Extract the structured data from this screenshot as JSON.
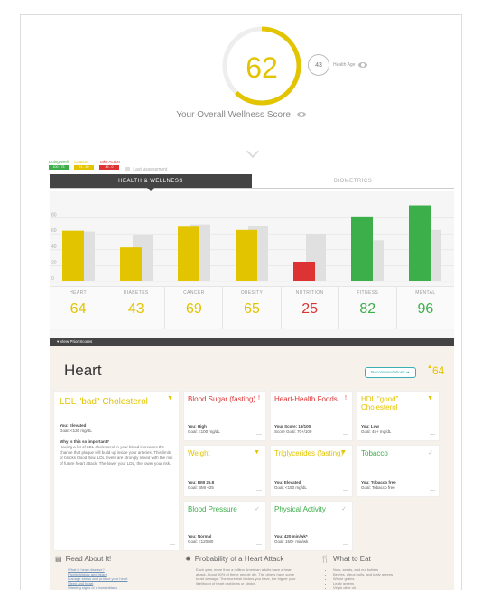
{
  "overall": {
    "score": "62",
    "score_value": 62,
    "label": "Your Overall Wellness Score"
  },
  "health_age": {
    "value": "43",
    "label": "Health Age"
  },
  "legend": [
    {
      "label": "Doing Well",
      "range": "100 - 75",
      "color": "#3cae4a"
    },
    {
      "label": "Caution",
      "range": "74 - 50",
      "color": "#e2c400"
    },
    {
      "label": "Take Action",
      "range": "49 - 0",
      "color": "#d33"
    }
  ],
  "last_assessment": "Last Assessment",
  "tabs": [
    {
      "label": "HEALTH & WELLNESS"
    },
    {
      "label": "BIOMETRICS"
    }
  ],
  "chart_data": {
    "type": "bar",
    "categories": [
      "HEART",
      "DIABETES",
      "CANCER",
      "OBESITY",
      "NUTRITION",
      "FITNESS",
      "MENTAL"
    ],
    "series": [
      {
        "values": [
          64,
          43,
          69,
          65,
          25,
          82,
          96
        ]
      },
      {
        "values": [
          63,
          58,
          72,
          70,
          60,
          52,
          65
        ]
      }
    ],
    "colors": [
      "#e2c400",
      "#e2c400",
      "#e2c400",
      "#e2c400",
      "#d33",
      "#3cae4a",
      "#3cae4a"
    ],
    "yticks": [
      "0",
      "20",
      "40",
      "60",
      "80"
    ],
    "ylim": [
      0,
      100
    ],
    "grid": true
  },
  "categories": [
    {
      "label": "HEART",
      "value": "64",
      "color": "#e2c400"
    },
    {
      "label": "DIABETES",
      "value": "43",
      "color": "#e2c400"
    },
    {
      "label": "CANCER",
      "value": "69",
      "color": "#e2c400"
    },
    {
      "label": "OBESITY",
      "value": "65",
      "color": "#e2c400"
    },
    {
      "label": "NUTRITION",
      "value": "25",
      "color": "#d33"
    },
    {
      "label": "FITNESS",
      "value": "82",
      "color": "#3cae4a"
    },
    {
      "label": "MENTAL",
      "value": "96",
      "color": "#3cae4a"
    }
  ],
  "view_prior": "View Prior Scores",
  "section": {
    "title": "Heart",
    "recommendations": "Recommendations",
    "score": "64"
  },
  "ldl": {
    "title": "LDL \"bad\" Cholesterol",
    "you": "You: Elevated",
    "goal": "Goal: <130 mg/dL",
    "why_title": "Why is this so important?",
    "why_text": "Having a lot of LDL cholesterol in your blood increases the chance that plaque will build up inside your arteries. This limits or blocks blood flow. LDL levels are strongly linked with the risk of future heart attack. The lower your LDL, the lower your risk."
  },
  "cards": [
    {
      "title": "Blood Sugar (fasting)",
      "you": "You: High",
      "goal": "Goal: <100 mg/dL",
      "icon": "!"
    },
    {
      "title": "Heart-Health Foods",
      "you": "Your Score: 19/100",
      "goal": "Score Goal: 70+/100",
      "icon": "!"
    },
    {
      "title": "HDL \"good\" Cholesterol",
      "you": "You: Low",
      "goal": "Goal: 45+ mg/dL",
      "icon": "▼"
    },
    {
      "title": "Weight",
      "you": "You: BMI 25.8",
      "goal": "Goal: BMI <25",
      "icon": "▼"
    },
    {
      "title": "Triglycerides (fasting)",
      "you": "You: Elevated",
      "goal": "Goal: <150 mg/dL",
      "icon": "▼"
    },
    {
      "title": "Tobacco",
      "you": "You: Tobacco free",
      "goal": "Goal: Tobacco free",
      "icon": "✓"
    },
    {
      "title": "Blood Pressure",
      "you": "You: Normal",
      "goal": "Goal: <120/80",
      "icon": "✓"
    },
    {
      "title": "Physical Activity",
      "you": "You: 420 min/wk*",
      "goal": "Goal: 150+ min/wk",
      "icon": "✓"
    }
  ],
  "read_about": {
    "title": "Read About It!",
    "links": [
      "What is heart disease?",
      "Family history and heart",
      "Manage stress and protect your heart",
      "Sleep and heart",
      "Warning signs of a heart attack"
    ]
  },
  "probability": {
    "title": "Probability of a Heart Attack",
    "text": "Each year, more than a million American adults have a heart attack. About 50% of these people die. The others have some heart damage. The more risk factors you have, the higher your likelihood of heart problems or stroke."
  },
  "what_to_eat": {
    "title": "What to Eat",
    "items": [
      "Nuts, seeds, and nut butters",
      "Berries, citrus fruits, and leafy greens",
      "Whole grains",
      "Leafy greens",
      "Virgin olive oil"
    ]
  }
}
